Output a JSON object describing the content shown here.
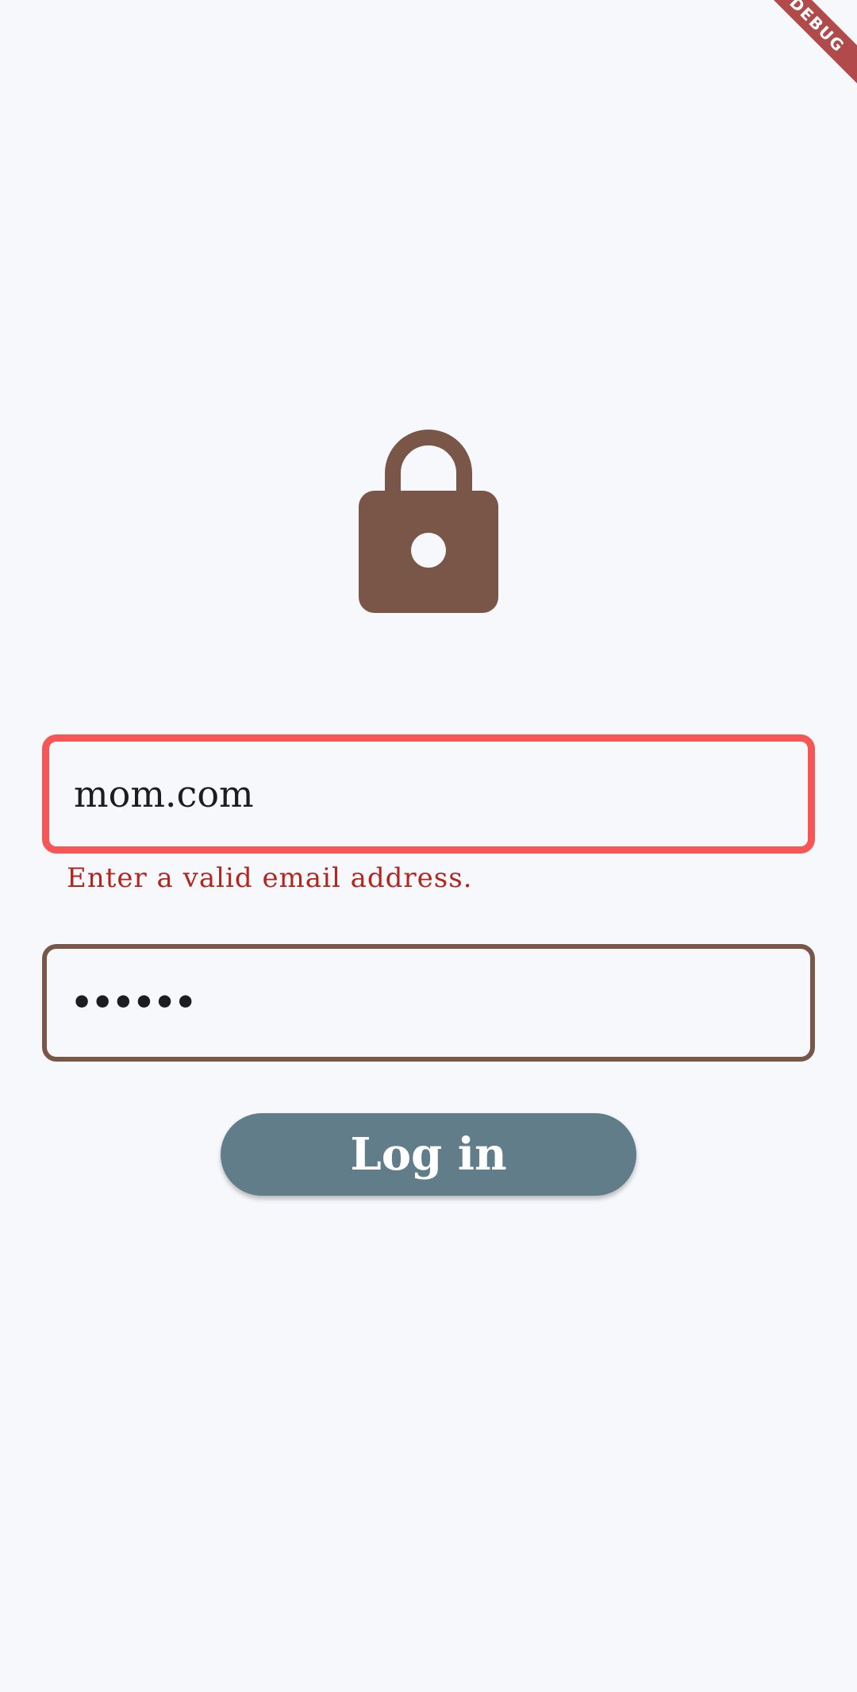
{
  "debug_banner": {
    "label": "DEBUG"
  },
  "icons": {
    "lock": "lock-icon"
  },
  "colors": {
    "background": "#f6f8fb",
    "lock": "#7a5648",
    "error_border": "#f65656",
    "error_text": "#b3261e",
    "field_border": "#7a5648",
    "button": "#617d8a"
  },
  "form": {
    "email": {
      "value": "mom.com",
      "error": "Enter a valid email address."
    },
    "password": {
      "masked_value": "••••••"
    },
    "login_button": {
      "label": "Log in"
    }
  }
}
